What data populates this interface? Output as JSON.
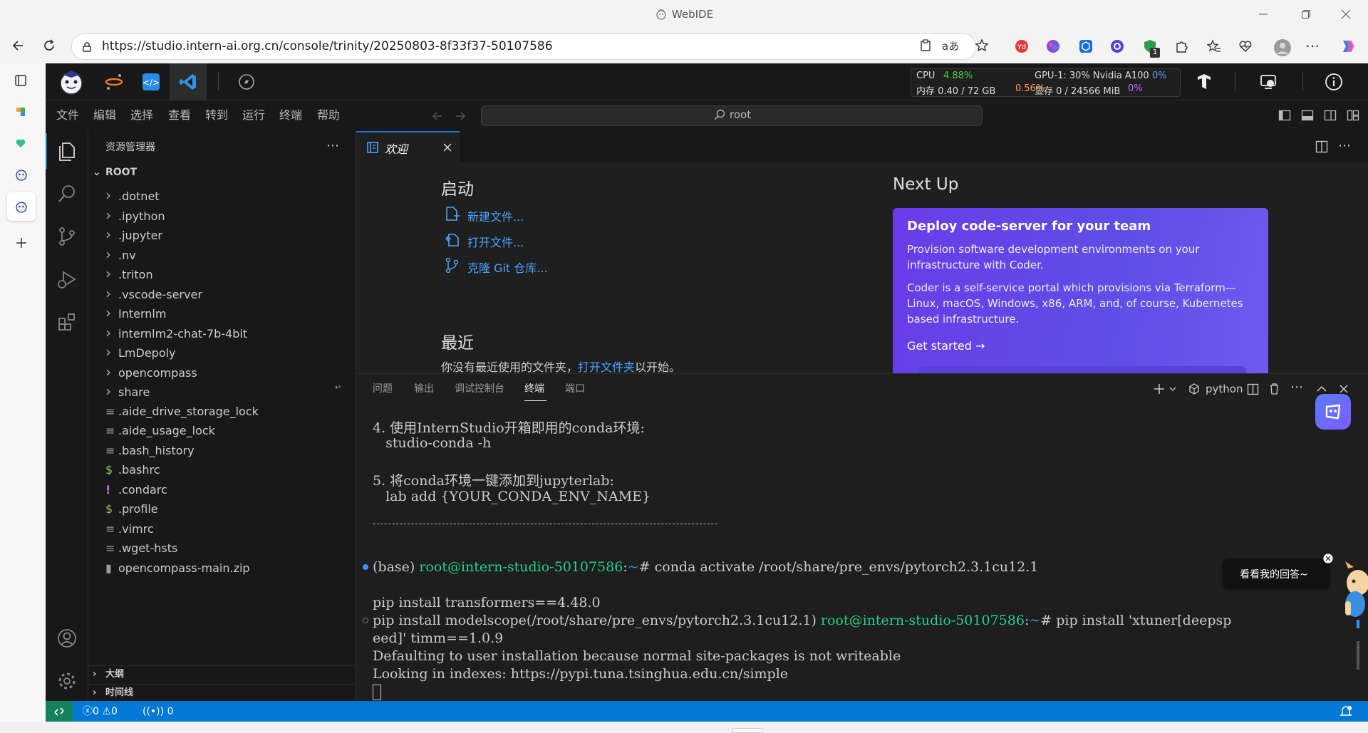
{
  "window": {
    "title": "WebIDE"
  },
  "browser": {
    "url": "https://studio.intern-ai.org.cn/console/trinity/20250803-8f33f37-50107586",
    "extension_badge": "1"
  },
  "monitor": {
    "cpu_label": "CPU",
    "cpu_value": "4.88%",
    "mem_label": "内存 0.40 / 72 GB",
    "mem_value": "0.56%",
    "gpu_label": "GPU-1: 30% Nvidia A100",
    "gpu_value": "0%",
    "vram_label": "显存 0 / 24566 MiB",
    "vram_value": "0%"
  },
  "menu": [
    "文件",
    "编辑",
    "选择",
    "查看",
    "转到",
    "运行",
    "终端",
    "帮助"
  ],
  "search": {
    "text": "root"
  },
  "explorer": {
    "title": "资源管理器",
    "root": "ROOT",
    "items": [
      {
        "name": ".dotnet",
        "kind": "folder"
      },
      {
        "name": ".ipython",
        "kind": "folder"
      },
      {
        "name": ".jupyter",
        "kind": "folder"
      },
      {
        "name": ".nv",
        "kind": "folder"
      },
      {
        "name": ".triton",
        "kind": "folder"
      },
      {
        "name": ".vscode-server",
        "kind": "folder"
      },
      {
        "name": "Internlm",
        "kind": "folder"
      },
      {
        "name": "internlm2-chat-7b-4bit",
        "kind": "folder"
      },
      {
        "name": "LmDepoly",
        "kind": "folder"
      },
      {
        "name": "opencompass",
        "kind": "folder"
      },
      {
        "name": "share",
        "kind": "folder"
      },
      {
        "name": ".aide_drive_storage_lock",
        "kind": "file"
      },
      {
        "name": ".aide_usage_lock",
        "kind": "file"
      },
      {
        "name": ".bash_history",
        "kind": "file"
      },
      {
        "name": ".bashrc",
        "kind": "shell"
      },
      {
        "name": ".condarc",
        "kind": "yaml"
      },
      {
        "name": ".profile",
        "kind": "shell"
      },
      {
        "name": ".vimrc",
        "kind": "file"
      },
      {
        "name": ".wget-hsts",
        "kind": "file"
      },
      {
        "name": "opencompass-main.zip",
        "kind": "zip"
      }
    ],
    "outline": "大纲",
    "timeline": "时间线"
  },
  "tab": {
    "label": "欢迎"
  },
  "welcome": {
    "start_title": "启动",
    "new_file": "新建文件...",
    "open_file": "打开文件...",
    "clone_git": "克隆 Git 仓库...",
    "recent_title": "最近",
    "recent_text_before": "你没有最近使用的文件夹，",
    "recent_link": "打开文件夹",
    "recent_text_after": "以开始。",
    "next_up_title": "Next Up",
    "card_title": "Deploy code-server for your team",
    "card_p1": "Provision software development environments on your infrastructure with Coder.",
    "card_p2": "Coder is a self-service portal which provisions via Terraform—Linux, macOS, Windows, x86, ARM, and, of course, Kubernetes based infrastructure.",
    "card_cta": "Get started"
  },
  "panel": {
    "tabs": [
      "问题",
      "输出",
      "调试控制台",
      "终端",
      "端口"
    ],
    "active_tab": "终端",
    "shell": "python"
  },
  "terminal": {
    "l1": "4. 使用InternStudio开箱即用的conda环境:",
    "l2": "   studio-conda -h",
    "l3": "5. 将conda环境一键添加到jupyterlab:",
    "l4": "   lab add {YOUR_CONDA_ENV_NAME}",
    "rule": "------------------------------------------------------------------------------------------",
    "p1_base": "(base) ",
    "p1_user": "root@intern-studio-50107586",
    "p1_colon": ":",
    "p1_tilde": "~",
    "p1_cmd": "# conda activate /root/share/pre_envs/pytorch2.3.1cu12.1",
    "l6": "pip install transformers==4.48.0",
    "p2_pre": "pip install modelscope(/root/share/pre_envs/pytorch2.3.1cu12.1) ",
    "p2_user": "root@intern-studio-50107586",
    "p2_colon": ":",
    "p2_tilde": "~",
    "p2_cmd": "# pip install 'xtuner[deepsp",
    "l8": "eed]' timm==1.0.9",
    "l9": "Defaulting to user installation because normal site-packages is not writeable",
    "l10": "Looking in indexes: https://pypi.tuna.tsinghua.edu.cn/simple"
  },
  "assistant": {
    "bubble": "看看我的回答~"
  },
  "status": {
    "errors": "0",
    "warnings": "0",
    "ports": "0"
  }
}
